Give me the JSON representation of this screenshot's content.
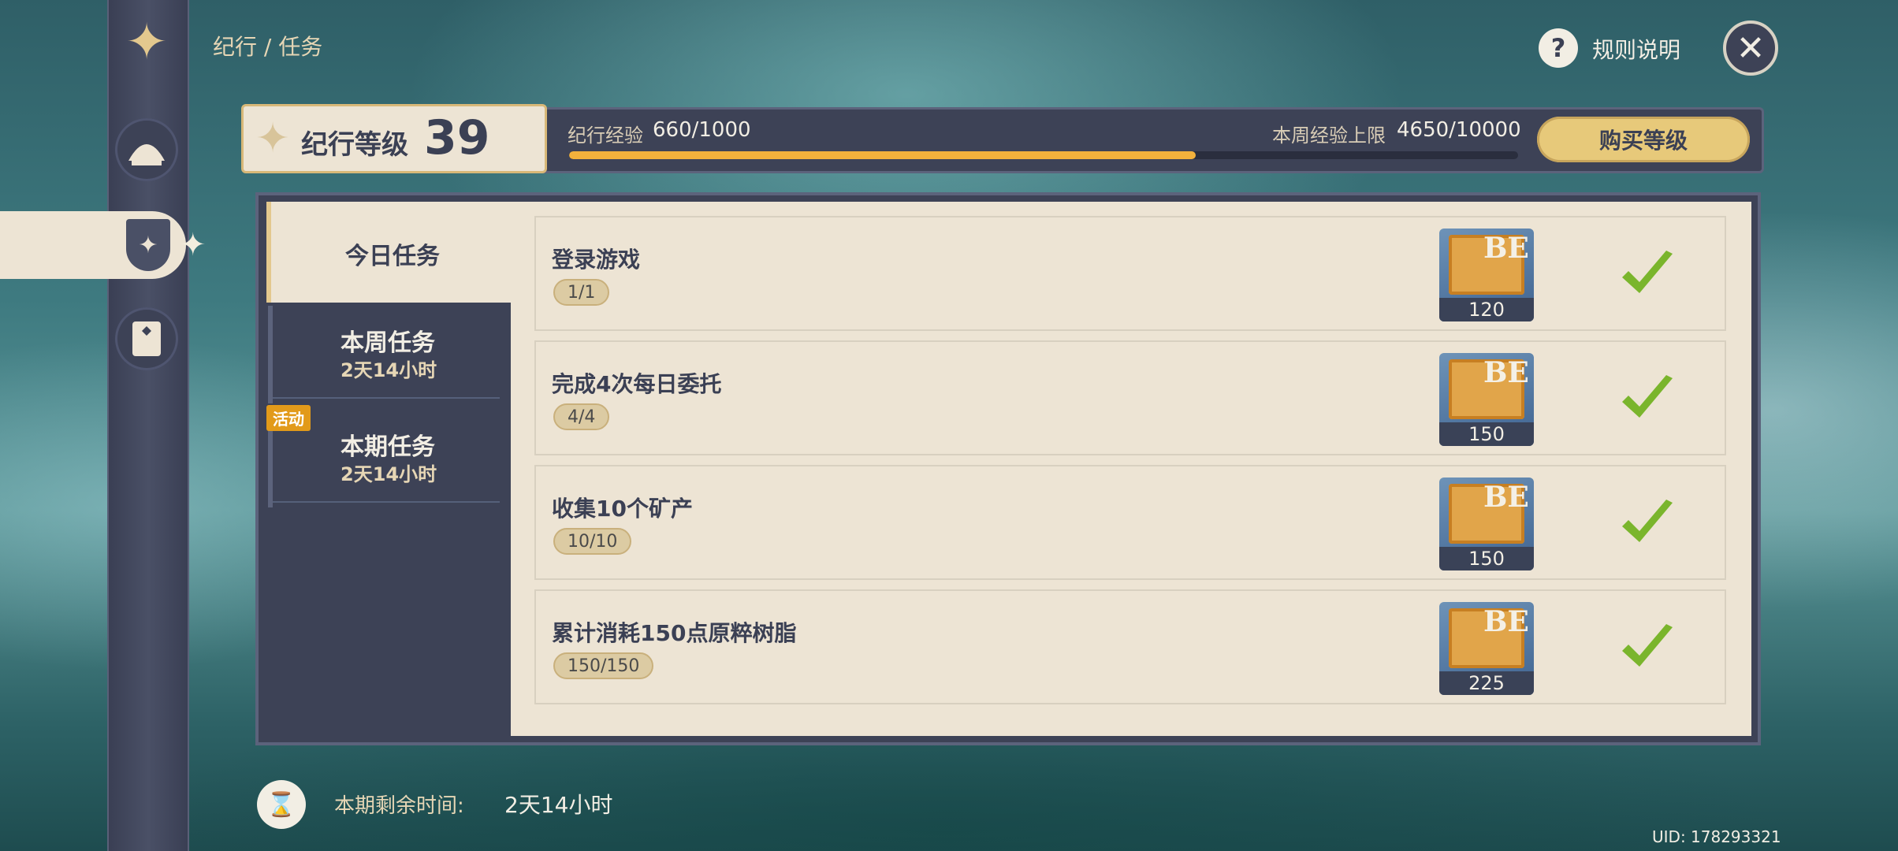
{
  "breadcrumb": "纪行 / 任务",
  "header": {
    "rules_label": "规则说明",
    "rules_icon": "?"
  },
  "level": {
    "label": "纪行等级",
    "number": "39",
    "exp_label": "纪行经验",
    "exp_value": "660/1000",
    "exp_progress_pct": 66,
    "week_label": "本周经验上限",
    "week_value": "4650/10000",
    "buy_label": "购买等级"
  },
  "tabs": [
    {
      "title": "今日任务",
      "sub": ""
    },
    {
      "title": "本周任务",
      "sub": "2天14小时"
    },
    {
      "title": "本期任务",
      "sub": "2天14小时",
      "badge": "活动"
    }
  ],
  "tasks": [
    {
      "title": "登录游戏",
      "progress": "1/1",
      "reward": "120",
      "reward_letters": "BE"
    },
    {
      "title": "完成4次每日委托",
      "progress": "4/4",
      "reward": "150",
      "reward_letters": "BE"
    },
    {
      "title": "收集10个矿产",
      "progress": "10/10",
      "reward": "150",
      "reward_letters": "BE"
    },
    {
      "title": "累计消耗150点原粹树脂",
      "progress": "150/150",
      "reward": "225",
      "reward_letters": "BE"
    }
  ],
  "timer": {
    "label": "本期剩余时间:",
    "value": "2天14小时"
  },
  "uid": "UID: 178293321",
  "colors": {
    "accent": "#f2b13c",
    "panel": "#3d4256",
    "paper": "#ede4d4",
    "check": "#7ab52c"
  }
}
